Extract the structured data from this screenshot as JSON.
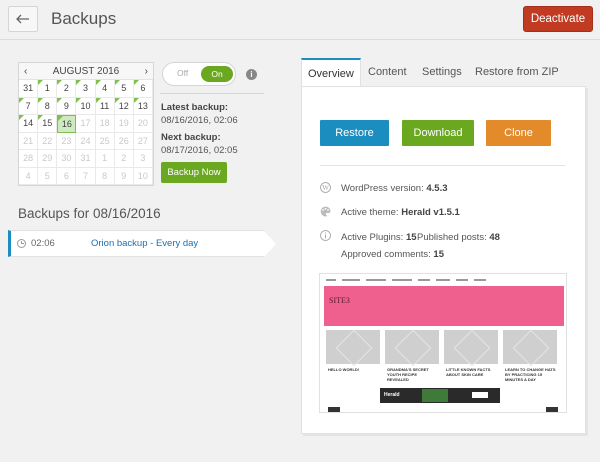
{
  "header": {
    "title": "Backups",
    "deactivate_label": "Deactivate"
  },
  "calendar": {
    "month_label": "AUGUST 2016",
    "prev": "‹",
    "next": "›",
    "days": [
      {
        "d": "31",
        "dim": false,
        "backup": false,
        "sel": false
      },
      {
        "d": "1",
        "dim": false,
        "backup": true,
        "sel": false
      },
      {
        "d": "2",
        "dim": false,
        "backup": true,
        "sel": false
      },
      {
        "d": "3",
        "dim": false,
        "backup": true,
        "sel": false
      },
      {
        "d": "4",
        "dim": false,
        "backup": true,
        "sel": false
      },
      {
        "d": "5",
        "dim": false,
        "backup": true,
        "sel": false
      },
      {
        "d": "6",
        "dim": false,
        "backup": true,
        "sel": false
      },
      {
        "d": "7",
        "dim": false,
        "backup": true,
        "sel": false
      },
      {
        "d": "8",
        "dim": false,
        "backup": true,
        "sel": false
      },
      {
        "d": "9",
        "dim": false,
        "backup": true,
        "sel": false
      },
      {
        "d": "10",
        "dim": false,
        "backup": true,
        "sel": false
      },
      {
        "d": "11",
        "dim": false,
        "backup": true,
        "sel": false
      },
      {
        "d": "12",
        "dim": false,
        "backup": true,
        "sel": false
      },
      {
        "d": "13",
        "dim": false,
        "backup": true,
        "sel": false
      },
      {
        "d": "14",
        "dim": false,
        "backup": true,
        "sel": false
      },
      {
        "d": "15",
        "dim": false,
        "backup": true,
        "sel": false
      },
      {
        "d": "16",
        "dim": false,
        "backup": true,
        "sel": true
      },
      {
        "d": "17",
        "dim": true,
        "backup": false,
        "sel": false
      },
      {
        "d": "18",
        "dim": true,
        "backup": false,
        "sel": false
      },
      {
        "d": "19",
        "dim": true,
        "backup": false,
        "sel": false
      },
      {
        "d": "20",
        "dim": true,
        "backup": false,
        "sel": false
      },
      {
        "d": "21",
        "dim": true,
        "backup": false,
        "sel": false
      },
      {
        "d": "22",
        "dim": true,
        "backup": false,
        "sel": false
      },
      {
        "d": "23",
        "dim": true,
        "backup": false,
        "sel": false
      },
      {
        "d": "24",
        "dim": true,
        "backup": false,
        "sel": false
      },
      {
        "d": "25",
        "dim": true,
        "backup": false,
        "sel": false
      },
      {
        "d": "26",
        "dim": true,
        "backup": false,
        "sel": false
      },
      {
        "d": "27",
        "dim": true,
        "backup": false,
        "sel": false
      },
      {
        "d": "28",
        "dim": true,
        "backup": false,
        "sel": false
      },
      {
        "d": "29",
        "dim": true,
        "backup": false,
        "sel": false
      },
      {
        "d": "30",
        "dim": true,
        "backup": false,
        "sel": false
      },
      {
        "d": "31",
        "dim": true,
        "backup": false,
        "sel": false
      },
      {
        "d": "1",
        "dim": true,
        "backup": false,
        "sel": false
      },
      {
        "d": "2",
        "dim": true,
        "backup": false,
        "sel": false
      },
      {
        "d": "3",
        "dim": true,
        "backup": false,
        "sel": false
      },
      {
        "d": "4",
        "dim": true,
        "backup": false,
        "sel": false
      },
      {
        "d": "5",
        "dim": true,
        "backup": false,
        "sel": false
      },
      {
        "d": "6",
        "dim": true,
        "backup": false,
        "sel": false
      },
      {
        "d": "7",
        "dim": true,
        "backup": false,
        "sel": false
      },
      {
        "d": "8",
        "dim": true,
        "backup": false,
        "sel": false
      },
      {
        "d": "9",
        "dim": true,
        "backup": false,
        "sel": false
      },
      {
        "d": "10",
        "dim": true,
        "backup": false,
        "sel": false
      }
    ]
  },
  "toggle": {
    "off_label": "Off",
    "on_label": "On",
    "state": "on"
  },
  "info": {
    "latest_label": "Latest backup:",
    "latest_value": "08/16/2016, 02:06",
    "next_label": "Next backup:",
    "next_value": "08/17/2016, 02:05",
    "backup_now_label": "Backup Now"
  },
  "backup_list": {
    "title": "Backups for 08/16/2016",
    "rows": [
      {
        "time": "02:06",
        "name": "Orion backup - Every day"
      }
    ]
  },
  "tabs": [
    "Overview",
    "Content",
    "Settings",
    "Restore from ZIP"
  ],
  "actions": {
    "restore_label": "Restore",
    "download_label": "Download",
    "clone_label": "Clone"
  },
  "details": {
    "wp_version_label": "WordPress version:",
    "wp_version": "4.5.3",
    "theme_label": "Active theme:",
    "theme": "Herald v1.5.1",
    "plugins_label": "Active Plugins:",
    "plugins": "15",
    "posts_label": "Published posts:",
    "posts": "48",
    "comments_label": "Approved comments:",
    "comments": "15"
  },
  "preview": {
    "site_name": "SITE3",
    "card_titles": [
      "HELLO WORLD!",
      "GRANDMA'S SECRET YOUTH RECIPE REVEALED",
      "LITTLE KNOWN FACTS ABOUT SKIN CARE",
      "LEARN TO CHANGE HATS BY PRACTICING 15 MINUTES A DAY"
    ],
    "ad_brand": "Herald"
  },
  "colors": {
    "accent": "#1b8dbf",
    "green": "#6aa820",
    "danger": "#c03b22",
    "clone": "#e38b2b",
    "hero_pink": "#f0608f"
  }
}
